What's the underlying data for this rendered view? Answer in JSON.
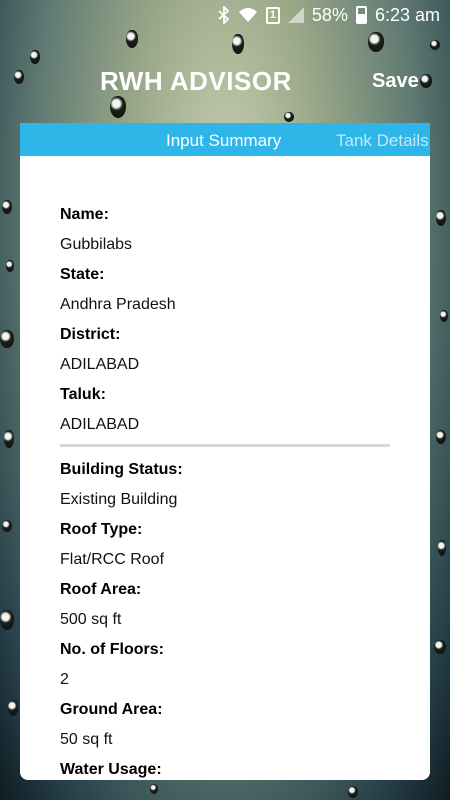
{
  "status_bar": {
    "battery": "58%",
    "time": "6:23 am",
    "sim_label": "1"
  },
  "app_bar": {
    "title": "RWH ADVISOR",
    "action_label": "Save"
  },
  "tabs": [
    {
      "label": "Input Summary",
      "active": true
    },
    {
      "label": "Tank Details",
      "active": false
    }
  ],
  "summary": {
    "location": [
      {
        "label": "Name:",
        "value": "Gubbilabs"
      },
      {
        "label": "State:",
        "value": "Andhra Pradesh"
      },
      {
        "label": "District:",
        "value": "ADILABAD"
      },
      {
        "label": "Taluk:",
        "value": "ADILABAD"
      }
    ],
    "building": [
      {
        "label": "Building Status:",
        "value": "Existing Building"
      },
      {
        "label": "Roof Type:",
        "value": "Flat/RCC Roof"
      },
      {
        "label": "Roof Area:",
        "value": "500 sq ft"
      },
      {
        "label": "No. of Floors:",
        "value": "2"
      },
      {
        "label": "Ground Area:",
        "value": "50 sq ft"
      },
      {
        "label": "Water Usage:",
        "value": ""
      }
    ]
  },
  "colors": {
    "tab_bar": "#2fb6e9",
    "card": "#ffffff",
    "text": "#000000"
  }
}
